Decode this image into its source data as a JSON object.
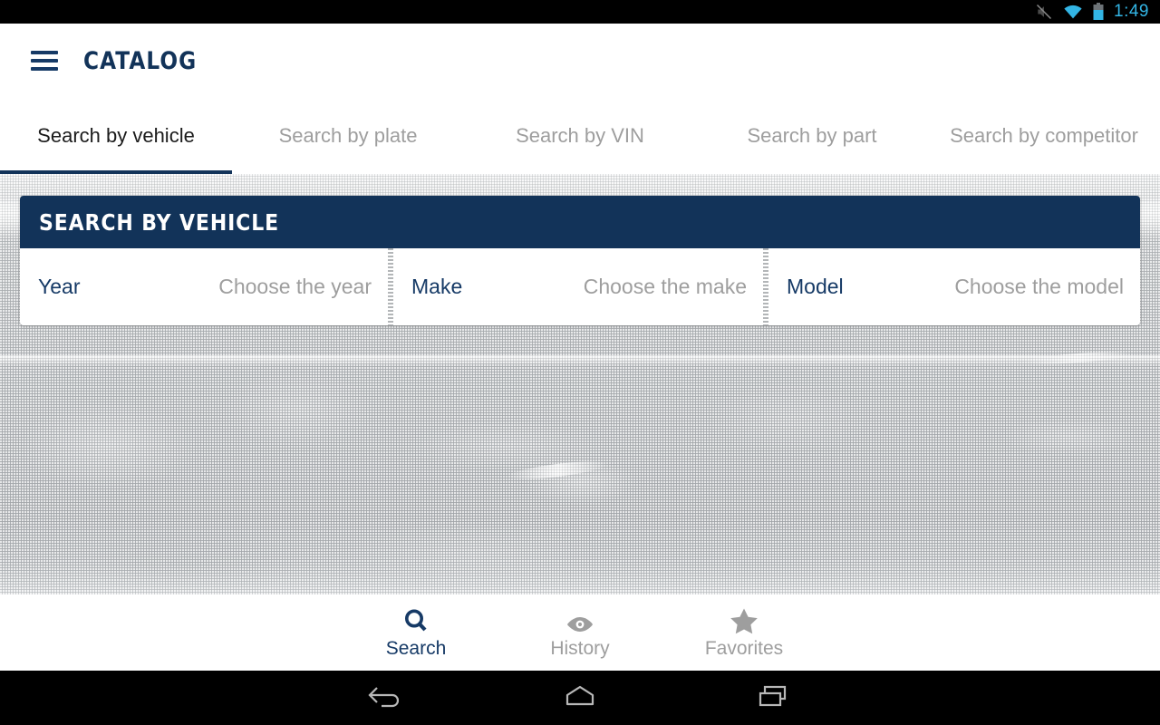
{
  "statusbar": {
    "time": "1:49",
    "icons": [
      "mute-icon",
      "wifi-icon",
      "battery-icon"
    ],
    "time_color": "#33b5e5"
  },
  "appbar": {
    "menu_icon": "hamburger-menu-icon",
    "title": "CATALOG"
  },
  "tabs": [
    {
      "label": "Search by vehicle",
      "active": true
    },
    {
      "label": "Search by plate",
      "active": false
    },
    {
      "label": "Search by VIN",
      "active": false
    },
    {
      "label": "Search by part",
      "active": false
    },
    {
      "label": "Search by competitor",
      "active": false
    }
  ],
  "card": {
    "title": "SEARCH BY VEHICLE",
    "fields": [
      {
        "label": "Year",
        "value": "Choose the year"
      },
      {
        "label": "Make",
        "value": "Choose the make"
      },
      {
        "label": "Model",
        "value": "Choose the model"
      }
    ]
  },
  "bottom_nav": [
    {
      "label": "Search",
      "icon": "search-icon",
      "active": true
    },
    {
      "label": "History",
      "icon": "eye-icon",
      "active": false
    },
    {
      "label": "Favorites",
      "icon": "star-icon",
      "active": false
    }
  ],
  "android_nav": [
    {
      "name": "back-button",
      "icon": "back-arrow-icon"
    },
    {
      "name": "home-button",
      "icon": "home-icon"
    },
    {
      "name": "recents-button",
      "icon": "recents-icon"
    }
  ],
  "colors": {
    "brand_navy": "#123359",
    "accent_cyan": "#33b5e5",
    "muted_gray": "#9e9e9e"
  }
}
